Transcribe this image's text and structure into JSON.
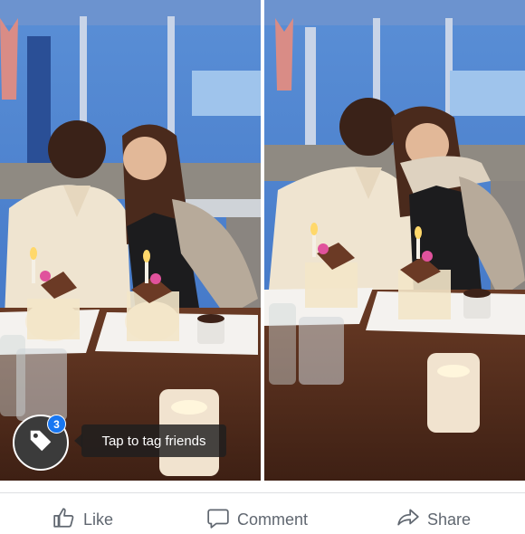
{
  "tag": {
    "badge_count": "3",
    "tooltip": "Tap to tag friends"
  },
  "actions": {
    "like_label": "Like",
    "comment_label": "Comment",
    "share_label": "Share"
  },
  "icons": {
    "tag": "tag-icon",
    "like": "thumbs-up-icon",
    "comment": "comment-bubble-icon",
    "share": "share-arrow-icon"
  },
  "colors": {
    "badge": "#1877f2",
    "action_text": "#606770",
    "divider": "#dddfe2"
  }
}
